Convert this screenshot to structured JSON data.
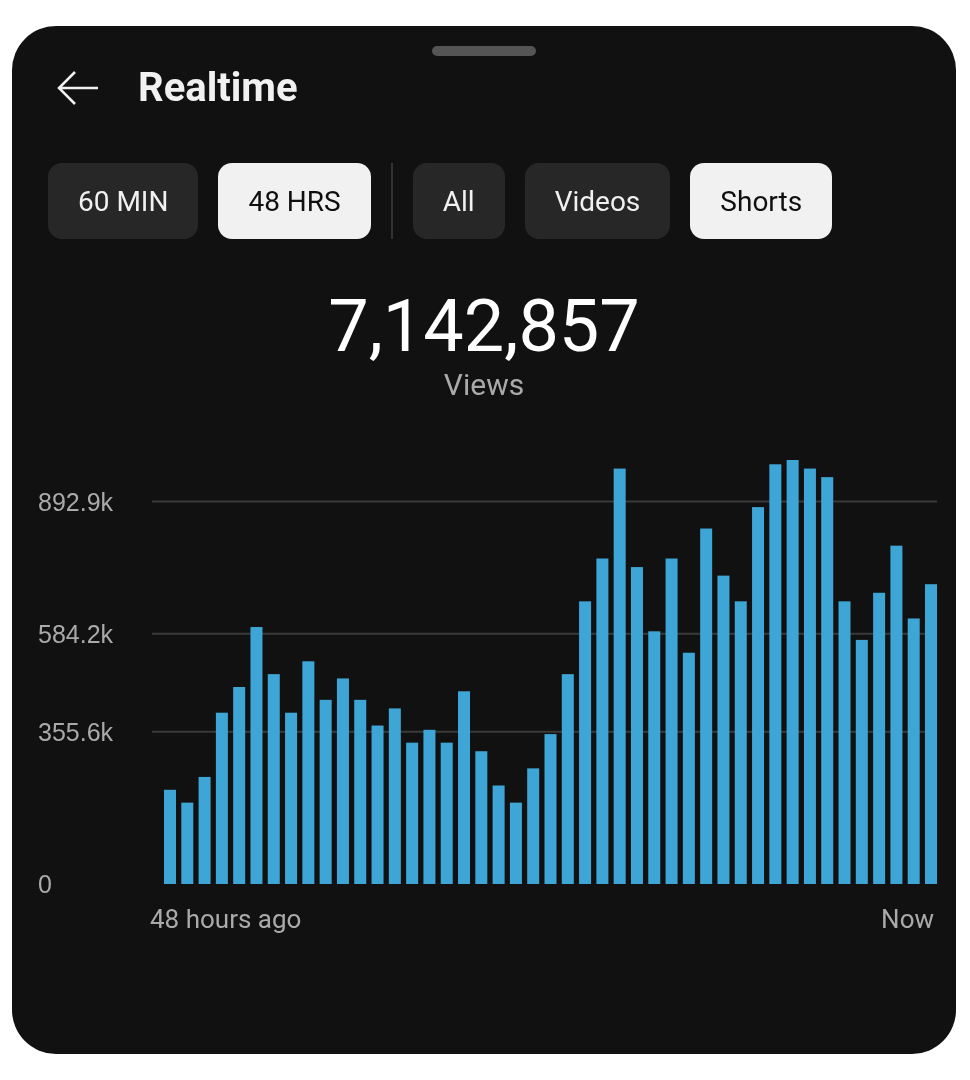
{
  "header": {
    "title": "Realtime"
  },
  "time_filters": [
    {
      "label": "60 MIN",
      "selected": false
    },
    {
      "label": "48 HRS",
      "selected": true
    }
  ],
  "content_filters": [
    {
      "label": "All",
      "selected": false
    },
    {
      "label": "Videos",
      "selected": false
    },
    {
      "label": "Shorts",
      "selected": true
    }
  ],
  "total": {
    "value": "7,142,857",
    "label": "Views"
  },
  "chart": {
    "axis_start": "48 hours ago",
    "axis_end": "Now",
    "chart_data": {
      "type": "bar",
      "color": "#3ea6d6",
      "values": [
        220000,
        190000,
        250000,
        400000,
        460000,
        600000,
        490000,
        400000,
        520000,
        430000,
        480000,
        430000,
        370000,
        410000,
        330000,
        360000,
        330000,
        450000,
        310000,
        230000,
        190000,
        270000,
        350000,
        490000,
        660000,
        760000,
        970000,
        740000,
        590000,
        760000,
        540000,
        830000,
        720000,
        660000,
        880000,
        980000,
        990000,
        970000,
        950000,
        660000,
        570000,
        680000,
        790000,
        620000,
        700000
      ],
      "grid": true,
      "ylim": [
        0,
        990000
      ],
      "yticks": [
        {
          "value": 0,
          "label": "0"
        },
        {
          "value": 355600,
          "label": "355.6k"
        },
        {
          "value": 584200,
          "label": "584.2k"
        },
        {
          "value": 892900,
          "label": "892.9k"
        }
      ]
    }
  }
}
